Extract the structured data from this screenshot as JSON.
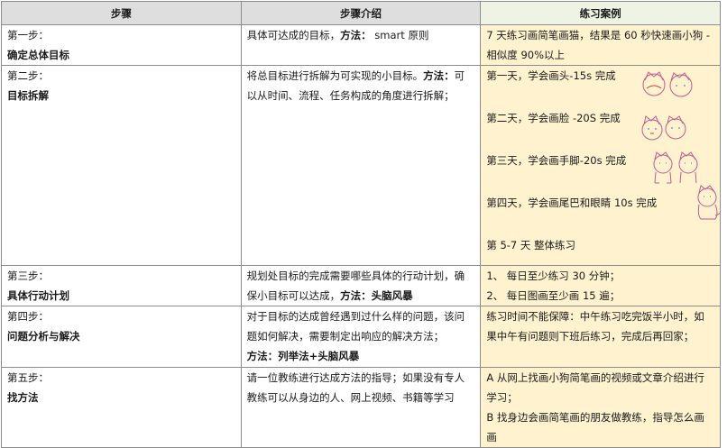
{
  "headers": {
    "step": "步骤",
    "intro": "步骤介绍",
    "case": "练习案例"
  },
  "rows": [
    {
      "step_no": "第一步：",
      "step_name": "确定总体目标",
      "intro_text": "具体可达成的目标，",
      "intro_method_label": "方法：",
      "intro_method_value": " smart 原则",
      "case_text": "7 天练习画简笔画猫，结果是 60 秒快速画小狗 -相似度 90%以上"
    },
    {
      "step_no": "第二步：",
      "step_name": "目标拆解",
      "intro_text": "将总目标进行拆解为可实现的小目标。",
      "intro_method_label": "方法：",
      "intro_method_value": "可以从时间、流程、任务构成的角度进行拆解；",
      "case_days": [
        {
          "text": "第一天，学会画头-15s 完成",
          "sketch": "cat-head-sketch"
        },
        {
          "text": "第二天，学会画脸  -20S 完成",
          "sketch": "cat-face-sketch"
        },
        {
          "text": "第三天，学会画手脚-20s 完成",
          "sketch": "cat-paws-sketch"
        },
        {
          "text": "第四天，学会画尾巴和眼睛 10s 完成",
          "sketch": "cat-full-sketch"
        }
      ],
      "case_final": "第 5-7 天  整体练习"
    },
    {
      "step_no": "第三步：",
      "step_name": "具体行动计划",
      "intro_text": "规划处目标的完成需要哪些具体的行动计划，确保小目标可以达成，",
      "intro_method_label": "方法：",
      "intro_method_value": "头脑风暴",
      "case_lines": [
        "1、  每日至少练习 30 分钟；",
        "2、  每日图画至少画 15 遍；"
      ]
    },
    {
      "step_no": "第四步：",
      "step_name": "问题分析与解决",
      "intro_text": "对于目标的达成曾经遇到过什么样的问题，该问题如何解决，需要制定出响应的解决方法；",
      "intro_method_label": "方法：",
      "intro_method_value": "列举法+头脑风暴",
      "case_text": "练习时间不能保障：中午练习吃完饭半小时，如果中午有问题则下班后练习，完成后再回家；"
    },
    {
      "step_no": "第五步：",
      "step_name": "找方法",
      "intro_text": "请一位教练进行达成方法的指导；如果没有专人教练可以从身边的人、网上视频、书籍等学习",
      "case_lines": [
        "A 从网上找画小狗简笔画的视频或文章介绍进行学习；",
        "B 找身边会画简笔画的朋友做教练，指导怎么画画"
      ]
    }
  ]
}
